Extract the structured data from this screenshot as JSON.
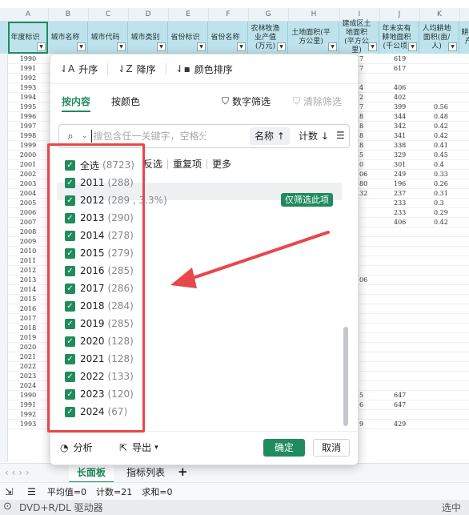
{
  "columns": [
    "A",
    "B",
    "C",
    "D",
    "E",
    "F",
    "G",
    "H",
    "I",
    "J",
    "K"
  ],
  "headers": [
    "年度标识",
    "城市名称",
    "城市代码",
    "城市类别",
    "省份标识",
    "省份名称",
    "农林牧渔业产值(万元)",
    "土地面积(平方公里)",
    "建成区土地面积(平方公里)",
    "年末实有耕地面积(千公顷)",
    "人均耕地面积(亩/人)",
    "耕地产"
  ],
  "years_left": [
    "1990",
    "1991",
    "1992",
    "1993",
    "1994",
    "1995",
    "1996",
    "1997",
    "1998",
    "1999",
    "2000",
    "2001",
    "2002",
    "2003",
    "2004",
    "2005",
    "2006",
    "2007",
    "2008",
    "2009",
    "2010",
    "2011",
    "2012",
    "2013",
    "2014",
    "2015",
    "2016",
    "2017",
    "2018",
    "2019",
    "2020",
    "2021",
    "2022",
    "2023",
    "2024",
    "1990",
    "1991",
    "1992",
    "1993"
  ],
  "col_i": [
    "7",
    "7",
    "",
    "4",
    "2",
    "7",
    "8",
    "8",
    "8",
    "8",
    "5",
    "0",
    "06",
    "80",
    "32",
    "",
    "",
    "",
    "",
    "",
    "",
    "",
    "",
    "06",
    "",
    "",
    "",
    "",
    "",
    "",
    "",
    "",
    "",
    "",
    "",
    "5",
    "6",
    "",
    "9"
  ],
  "col_j": [
    "619",
    "617",
    "",
    "406",
    "402",
    "399",
    "344",
    "342",
    "341",
    "338",
    "329",
    "301",
    "249",
    "196",
    "237",
    "233",
    "233",
    "406",
    "",
    "",
    "",
    "",
    "",
    "",
    "",
    "",
    "",
    "",
    "",
    "",
    "",
    "",
    "",
    "",
    "",
    "647",
    "647",
    "",
    "429"
  ],
  "col_k": [
    "",
    "",
    "",
    "",
    "",
    "0.56",
    "0.48",
    "0.42",
    "0.42",
    "0.41",
    "0.45",
    "0.4",
    "0.33",
    "0.26",
    "0.31",
    "0.3",
    "0.29",
    "0.42",
    "",
    "",
    "",
    "",
    "",
    "",
    "",
    "",
    "",
    "",
    "",
    "",
    "",
    "",
    "",
    "",
    "",
    "",
    "",
    "",
    ""
  ],
  "sort": {
    "asc": "升序",
    "desc": "降序",
    "color": "颜色排序"
  },
  "tabs": {
    "by_content": "按内容",
    "by_color": "按颜色",
    "number_filter": "数字筛选",
    "clear_filter": "清除筛选"
  },
  "search": {
    "placeholder": "搜包含任一关键字，空格分隔",
    "sort_name": "名称 ↑",
    "sort_count": "计数 ↓"
  },
  "toolbar": {
    "select_all": "全选",
    "select_all_count": "(8723)",
    "invert": "反选",
    "duplicates": "重复项",
    "more": "更多"
  },
  "items": [
    {
      "label": "2011",
      "count": "(288)"
    },
    {
      "label": "2012",
      "count": "(289 , 3.3%)"
    },
    {
      "label": "2013",
      "count": "(290)"
    },
    {
      "label": "2014",
      "count": "(278)"
    },
    {
      "label": "2015",
      "count": "(279)"
    },
    {
      "label": "2016",
      "count": "(285)"
    },
    {
      "label": "2017",
      "count": "(286)"
    },
    {
      "label": "2018",
      "count": "(284)"
    },
    {
      "label": "2019",
      "count": "(285)"
    },
    {
      "label": "2020",
      "count": "(128)"
    },
    {
      "label": "2021",
      "count": "(128)"
    },
    {
      "label": "2022",
      "count": "(133)"
    },
    {
      "label": "2023",
      "count": "(120)"
    },
    {
      "label": "2024",
      "count": "(67)"
    }
  ],
  "only_this": "仅筛选此项",
  "footer": {
    "analyze": "分析",
    "export": "导出",
    "ok": "确定",
    "cancel": "取消"
  },
  "sheet_tabs": [
    "长面板",
    "指标列表"
  ],
  "add_sheet": "+",
  "status": {
    "avg": "平均值=0",
    "count": "计数=21",
    "sum": "求和=0"
  },
  "taskbar": {
    "drive": "DVD+R/DL 驱动器",
    "right": "选中"
  },
  "colors": {
    "accent": "#1f8b5e",
    "annotation": "#e8474b",
    "header_bg": "#bfe3ec"
  }
}
